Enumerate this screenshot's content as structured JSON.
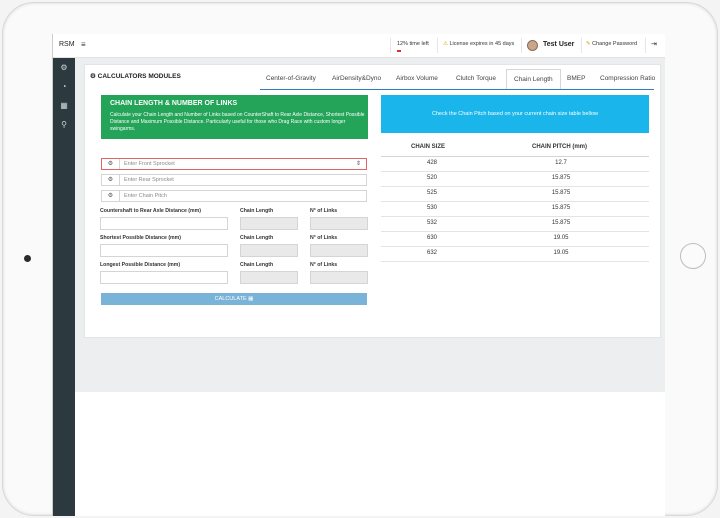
{
  "topbar": {
    "brand": "RSM",
    "time_left": "12% time left",
    "license": "License expires in 45 days",
    "user": "Test User",
    "change_password": "Change Password"
  },
  "calculators": {
    "title": "CALCULATORS MODULES",
    "tabs": [
      "Center-of-Gravity",
      "AirDensity&Dyno",
      "Airbox Volume",
      "Clutch Torque",
      "Chain Length",
      "BMEP",
      "Compression Ratio"
    ],
    "active_tab": "Chain Length"
  },
  "chain": {
    "heading": "CHAIN LENGTH & NUMBER OF LINKS",
    "description": "Calculate your Chain Length and Number of Links based on CounterShaft to Rear Axle Distance, Shortest Possible Distance and Maximum Possible Distance. Particularly useful for those who Drag Race with custom longer swingarms.",
    "front_sprocket_placeholder": "Enter Front Sprocket",
    "rear_sprocket_placeholder": "Enter Rear Sprocket",
    "chain_pitch_placeholder": "Enter Chain Pitch",
    "rows": [
      {
        "distance_label": "Countershaft to Rear Axle Distance (mm)",
        "length_label": "Chain Length",
        "links_label": "N° of Links"
      },
      {
        "distance_label": "Shortest Possible Distance (mm)",
        "length_label": "Chain Length",
        "links_label": "N° of Links"
      },
      {
        "distance_label": "Longest Possible Distance (mm)",
        "length_label": "Chain Length",
        "links_label": "N° of Links"
      }
    ],
    "calculate_label": "CALCULATE ▦"
  },
  "pitch_table": {
    "notice": "Check the Chain Pitch based on your current chain size table bellow",
    "headers": [
      "CHAIN SIZE",
      "CHAIN PITCH (mm)"
    ],
    "rows": [
      [
        "428",
        "12.7"
      ],
      [
        "520",
        "15.875"
      ],
      [
        "525",
        "15.875"
      ],
      [
        "530",
        "15.875"
      ],
      [
        "532",
        "15.875"
      ],
      [
        "630",
        "19.05"
      ],
      [
        "632",
        "19.05"
      ]
    ]
  }
}
